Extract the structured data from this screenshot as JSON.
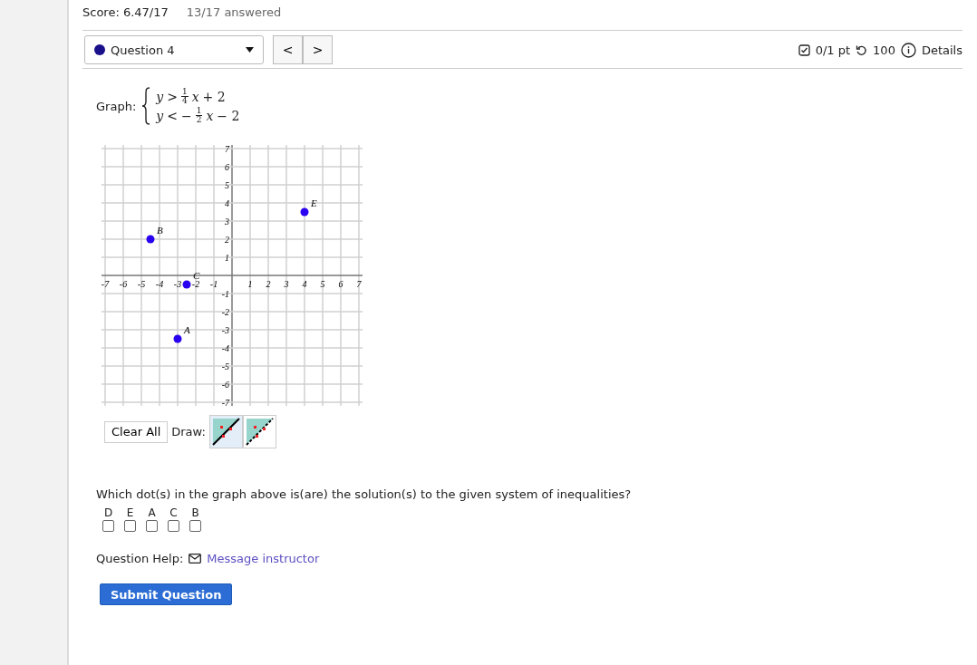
{
  "score": {
    "label": "Score: 6.47/17",
    "answered": "13/17 answered"
  },
  "question_nav": {
    "question": "Question 4",
    "prev": "<",
    "next": ">"
  },
  "question_info": {
    "points": "0/1 pt",
    "attempts": "100",
    "details": "Details"
  },
  "prompt": {
    "label": "Graph:",
    "inequalities": [
      {
        "lhs": "y",
        "op": ">",
        "num": "1",
        "den": "4",
        "var": "x",
        "rest": "+ 2"
      },
      {
        "lhs": "y",
        "op": "<",
        "sign": "−",
        "num": "1",
        "den": "2",
        "var": "x",
        "rest": "− 2"
      }
    ]
  },
  "graph": {
    "chart_data": {
      "type": "scatter",
      "grid": true,
      "xlim": [
        -7,
        7
      ],
      "ylim": [
        -7,
        7
      ],
      "xticks": [
        -7,
        -6,
        -5,
        -4,
        -3,
        -2,
        -1,
        1,
        2,
        3,
        4,
        5,
        6,
        7
      ],
      "yticks": [
        -7,
        -6,
        -5,
        -4,
        -3,
        -2,
        -1,
        1,
        2,
        3,
        4,
        5,
        6,
        7
      ],
      "series": [
        {
          "color": "#2a00f0",
          "x": [
            -3,
            -4.5,
            -2.5,
            4
          ],
          "values": [
            -3.5,
            2,
            -0.5,
            3.5
          ]
        }
      ],
      "annotations": [
        {
          "text": "A",
          "x": -3,
          "y": -3.5
        },
        {
          "text": "B",
          "x": -4.5,
          "y": 2
        },
        {
          "text": "C",
          "x": -2.5,
          "y": -0.5
        },
        {
          "text": "E",
          "x": 4,
          "y": 3.5
        }
      ]
    }
  },
  "tools": {
    "clear": "Clear All",
    "draw": "Draw:",
    "modes": [
      {
        "kind": "solid",
        "selected": true
      },
      {
        "kind": "dashed",
        "selected": false
      }
    ]
  },
  "question": "Which dot(s) in the graph above is(are) the solution(s) to the given system of inequalities?",
  "choices": [
    {
      "label": "D",
      "checked": false
    },
    {
      "label": "E",
      "checked": false
    },
    {
      "label": "A",
      "checked": false
    },
    {
      "label": "C",
      "checked": false
    },
    {
      "label": "B",
      "checked": false
    }
  ],
  "help": {
    "label": "Question Help:",
    "link": "Message instructor"
  },
  "submit": "Submit Question"
}
